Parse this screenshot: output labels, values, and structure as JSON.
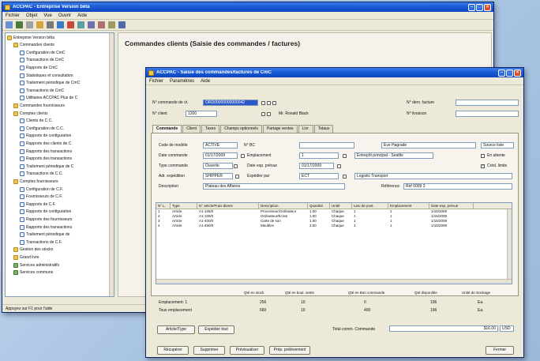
{
  "main_window": {
    "title": "ACCPAC - Entreprise Version bêta",
    "menu": [
      "Fichier",
      "Objet",
      "Vue",
      "Ouvrir",
      "Aide"
    ],
    "heading": "Commandes clients (Saisie des commandes / factures)",
    "status": "Appuyez sur F1 pour l'aide",
    "tree": [
      {
        "depth": 0,
        "icon": "folder",
        "label": "Entreprise Version bêta"
      },
      {
        "depth": 1,
        "icon": "folder",
        "label": "Commandes clients"
      },
      {
        "depth": 2,
        "icon": "doc",
        "label": "Configuration de CmC"
      },
      {
        "depth": 2,
        "icon": "doc",
        "label": "Transactions de CmC"
      },
      {
        "depth": 2,
        "icon": "doc",
        "label": "Rapports de CmC"
      },
      {
        "depth": 2,
        "icon": "doc",
        "label": "Statistiques et consultation"
      },
      {
        "depth": 2,
        "icon": "doc",
        "label": "Traitement périodique de CmC"
      },
      {
        "depth": 2,
        "icon": "doc",
        "label": "Transactions de CmC"
      },
      {
        "depth": 2,
        "icon": "doc",
        "label": "Utilitaires ACCPAC Plus de C"
      },
      {
        "depth": 1,
        "icon": "folder",
        "label": "Commandes fournisseurs"
      },
      {
        "depth": 1,
        "icon": "folder",
        "label": "Comptes clients"
      },
      {
        "depth": 2,
        "icon": "doc",
        "label": "Clients de C.C."
      },
      {
        "depth": 2,
        "icon": "doc",
        "label": "Configuration de C.C."
      },
      {
        "depth": 2,
        "icon": "doc",
        "label": "Rapports de configuration"
      },
      {
        "depth": 2,
        "icon": "doc",
        "label": "Rapports des clients de C"
      },
      {
        "depth": 2,
        "icon": "doc",
        "label": "Rapports des transactions"
      },
      {
        "depth": 2,
        "icon": "doc",
        "label": "Rapports des transactions"
      },
      {
        "depth": 2,
        "icon": "doc",
        "label": "Traitement périodique de C"
      },
      {
        "depth": 2,
        "icon": "doc",
        "label": "Transactions de C.C."
      },
      {
        "depth": 1,
        "icon": "folder",
        "label": "Comptes fournisseurs"
      },
      {
        "depth": 2,
        "icon": "doc",
        "label": "Configuration de C.F."
      },
      {
        "depth": 2,
        "icon": "doc",
        "label": "Fournisseurs de C.F."
      },
      {
        "depth": 2,
        "icon": "doc",
        "label": "Rapports de C.F."
      },
      {
        "depth": 2,
        "icon": "doc",
        "label": "Rapports de configuration"
      },
      {
        "depth": 2,
        "icon": "doc",
        "label": "Rapports des fournisseurs"
      },
      {
        "depth": 2,
        "icon": "doc",
        "label": "Rapports des transactions"
      },
      {
        "depth": 2,
        "icon": "doc",
        "label": "Traitement périodique de"
      },
      {
        "depth": 2,
        "icon": "doc",
        "label": "Transactions de C.F."
      },
      {
        "depth": 1,
        "icon": "folder",
        "label": "Gestion des stocks"
      },
      {
        "depth": 1,
        "icon": "folder",
        "label": "Grand livre"
      },
      {
        "depth": 1,
        "icon": "grp",
        "label": "Services administratifs"
      },
      {
        "depth": 1,
        "icon": "grp",
        "label": "Services communs"
      }
    ]
  },
  "dialog": {
    "title": "ACCPAC - Saisie des commandes/factures de CmC",
    "menu": [
      "Fichier",
      "Paramètres",
      "Aide"
    ],
    "header": {
      "order_no_label": "N° commande de vt.",
      "order_no": "ORD00000000000042",
      "customer_no_label": "N° client",
      "customer_no": "1200",
      "customer_name": "Mr. Ronald Black",
      "last_invoice_label": "N° dern. facture",
      "last_invoice": "",
      "last_shipment_label": "N° livraison",
      "last_shipment": ""
    },
    "tabs": [
      "Commande",
      "Client",
      "Taxes",
      "Champs optionnels",
      "Partage ventes",
      "Livr.",
      "Totaux"
    ],
    "form": {
      "order_code_label": "Code de modèle",
      "order_code": "ACTIVE",
      "po_label": "N° BC",
      "po": "",
      "ship_name": "Eve Hagrade",
      "reserve_label": "Source liste",
      "order_date_label": "Date commande",
      "order_date": "01/17/2009",
      "location_label": "Emplacement",
      "location": "1",
      "location_desc": "Entrepôt principal - Seattle",
      "on_hold_label": "En attente",
      "order_type_label": "Type commande",
      "order_type": "Ouverte",
      "expected_ship_label": "Date exp. prévue",
      "expected_ship": "01/17/2009",
      "credit_ok_label": "Créd. limite",
      "ship_via_label": "Adr. expédition",
      "ship_via": "SHIPPER",
      "ship_to_label": "Expédier par",
      "ship_to": "ECT",
      "ship_to_desc": "Logistic Transport",
      "description_label": "Description",
      "description": "Plateau des Affaires",
      "reference_label": "Référence",
      "reference": "Réf 0009 3"
    },
    "grid": {
      "columns": [
        "N° L.",
        "Type",
        "N° article/Frais divers",
        "Description",
        "Quantité",
        "Unité",
        "Lieu de post.",
        "Emplacement",
        "Date exp. prévue"
      ],
      "rows": [
        [
          "1",
          "Article",
          "A1-105/0",
          "Processeur/Ordinateur",
          "1.00",
          "Chaque",
          "1",
          "1",
          "1/15/2009"
        ],
        [
          "2",
          "Article",
          "A1-109/0",
          "Ordinateur/Écran",
          "1.00",
          "Chaque",
          "1",
          "1",
          "1/15/2009"
        ],
        [
          "3",
          "Article",
          "A1-400/0",
          "Carte de son",
          "1.00",
          "Chaque",
          "1",
          "1",
          "1/15/2009"
        ],
        [
          "4",
          "Article",
          "A1-450/0",
          "Meubles",
          "2.00",
          "Chaque",
          "1",
          "1",
          "1/15/2009"
        ]
      ]
    },
    "totals": {
      "headers": [
        "Qté en stock",
        "Qté en bout. vente",
        "Qté en Bon commande",
        "Qté disponible",
        "Unité de stockage"
      ],
      "rows": [
        {
          "label": "Emplacement: 1",
          "values": [
            "256",
            "10",
            "0",
            "196",
            "Ea."
          ]
        },
        {
          "label": "Tous emplacement",
          "values": [
            "660",
            "10",
            "400",
            "196",
            "Ea."
          ]
        }
      ]
    },
    "buttons_mid": [
      "Article/Type",
      "Expédier tout"
    ],
    "total_label": "Total comm. Commande",
    "total_value": "$16.00",
    "total_currency": "USD",
    "buttons_bottom": [
      "Récupérer",
      "Supprimer",
      "Prévisualiser",
      "Prép. prélèvement",
      "Fermer"
    ]
  }
}
